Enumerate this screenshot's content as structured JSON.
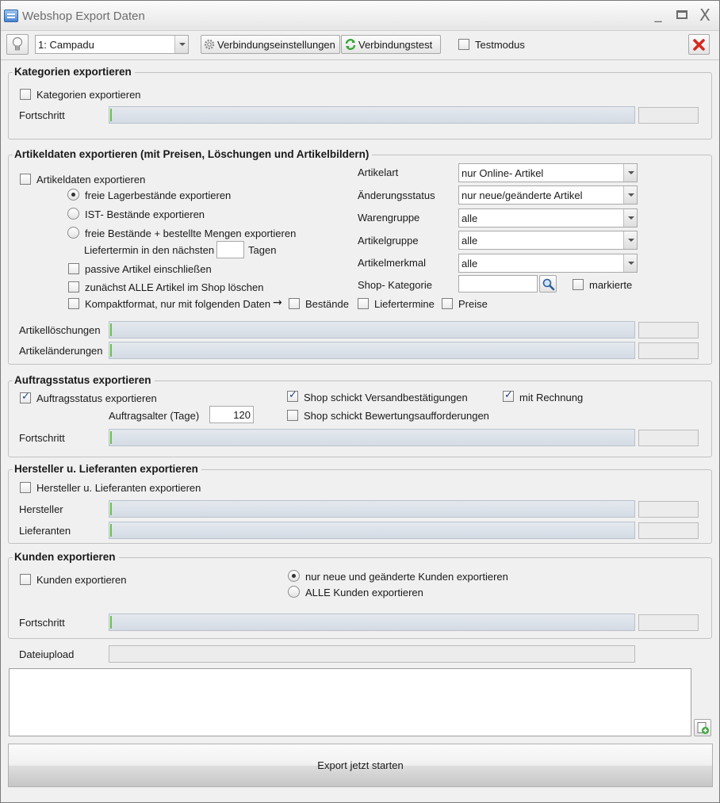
{
  "window": {
    "title": "Webshop Export Daten"
  },
  "toolbar": {
    "shop_select": "1: Campadu",
    "connection_settings_label": "Verbindungseinstellungen",
    "connection_test_label": "Verbindungstest",
    "test_mode_label": "Testmodus"
  },
  "categories": {
    "title": "Kategorien exportieren",
    "export_label": "Kategorien exportieren",
    "progress_label": "Fortschritt",
    "progress": 0
  },
  "articles": {
    "title": "Artikeldaten exportieren (mit Preisen, Löschungen und Artikelbildern)",
    "export_label": "Artikeldaten exportieren",
    "radio_free_stock": "freie Lagerbestände exportieren",
    "radio_actual_stock": "IST- Bestände exportieren",
    "radio_free_plus_ordered": "freie Bestände + bestellte Mengen exportieren",
    "delivery_days_prefix": "Liefertermin in den nächsten",
    "delivery_days_value": "",
    "delivery_days_suffix": "Tagen",
    "passive_label": "passive Artikel  einschließen",
    "delete_all_label": "zunächst ALLE Artikel im Shop löschen",
    "compact_label": "Kompaktformat, nur mit folgenden Daten",
    "compact_arrow": "→",
    "stock_label": "Bestände",
    "delivery_dates_label": "Liefertermine",
    "prices_label": "Preise",
    "filters": {
      "article_type_label": "Artikelart",
      "article_type_value": "nur Online- Artikel",
      "change_status_label": "Änderungsstatus",
      "change_status_value": "nur neue/geänderte Artikel",
      "product_group_label": "Warengruppe",
      "product_group_value": "alle",
      "article_group_label": "Artikelgruppe",
      "article_group_value": "alle",
      "article_feature_label": "Artikelmerkmal",
      "article_feature_value": "alle",
      "shop_category_label": "Shop- Kategorie",
      "shop_category_value": "",
      "marked_label": "markierte"
    },
    "deletions_label": "Artikellöschungen",
    "changes_label": "Artikeländerungen",
    "deletions_progress": 0,
    "changes_progress": 0
  },
  "orders": {
    "title": "Auftragsstatus exportieren",
    "export_label": "Auftragsstatus exportieren",
    "age_label": "Auftragsalter (Tage)",
    "age_value": "120",
    "shipping_confirm_label": "Shop schickt Versandbestätigungen",
    "with_invoice_label": "mit Rechnung",
    "review_request_label": "Shop schickt Bewertungsaufforderungen",
    "progress_label": "Fortschritt",
    "progress": 0
  },
  "manufacturers": {
    "title": "Hersteller u. Lieferanten exportieren",
    "export_label": "Hersteller u. Lieferanten exportieren",
    "manufacturer_label": "Hersteller",
    "supplier_label": "Lieferanten",
    "manufacturer_progress": 0,
    "supplier_progress": 0
  },
  "customers": {
    "title": "Kunden exportieren",
    "export_label": "Kunden exportieren",
    "radio_new_changed": "nur neue und geänderte Kunden exportieren",
    "radio_all": "ALLE Kunden exportieren",
    "progress_label": "Fortschritt",
    "progress": 0
  },
  "upload": {
    "label": "Dateiupload",
    "progress": 0
  },
  "log": {
    "text": ""
  },
  "start_button_label": "Export jetzt starten",
  "colors": {
    "progress_fill": "#6bc24b",
    "close_red": "#d42a1f",
    "check_blue": "#24408e"
  }
}
